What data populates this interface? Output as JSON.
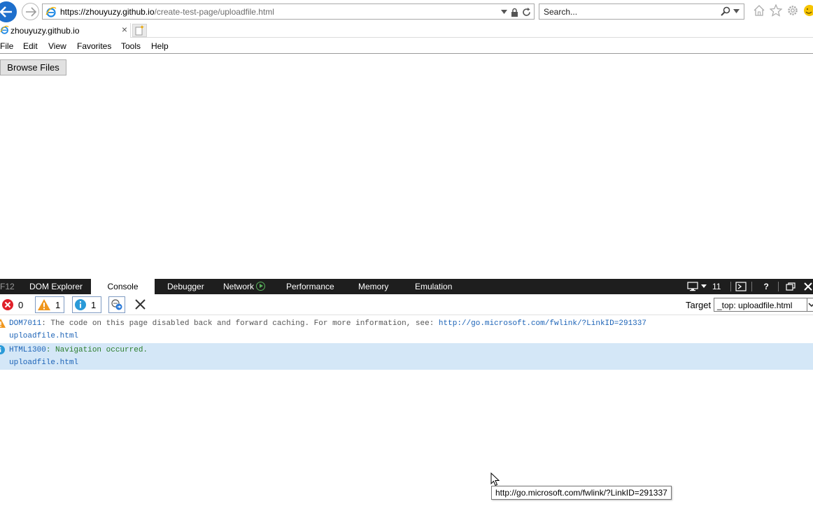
{
  "browser": {
    "url_host": "https://zhouyuzy.github.io",
    "url_path": "/create-test-page/uploadfile.html",
    "search_placeholder": "Search...",
    "tab_title": "zhouyuzy.github.io",
    "tab_close": "×",
    "accent_color": "#1e6fcc"
  },
  "menu": {
    "items": [
      "File",
      "Edit",
      "View",
      "Favorites",
      "Tools",
      "Help"
    ]
  },
  "page": {
    "browse_button_label": "Browse Files"
  },
  "devtools": {
    "f12_label": "F12",
    "tabs": [
      "DOM Explorer",
      "Console",
      "Debugger",
      "Network",
      "Performance",
      "Memory",
      "Emulation"
    ],
    "active_tab": "Console",
    "document_mode": "11",
    "help_label": "?",
    "counters": {
      "errors": "0",
      "warnings": "1",
      "info": "1"
    },
    "target_label": "Target",
    "target_value": "_top: uploadfile.html",
    "messages": [
      {
        "level": "warning",
        "code": "DOM7011",
        "text": ": The code on this page disabled back and forward caching. For more information, see: ",
        "link": "http://go.microsoft.com/fwlink/?LinkID=291337",
        "source": "uploadfile.html"
      },
      {
        "level": "info",
        "code": "HTML1300",
        "text": ": Navigation occurred.",
        "link": "",
        "source": "uploadfile.html"
      }
    ]
  },
  "tooltip": {
    "text": "http://go.microsoft.com/fwlink/?LinkID=291337"
  }
}
